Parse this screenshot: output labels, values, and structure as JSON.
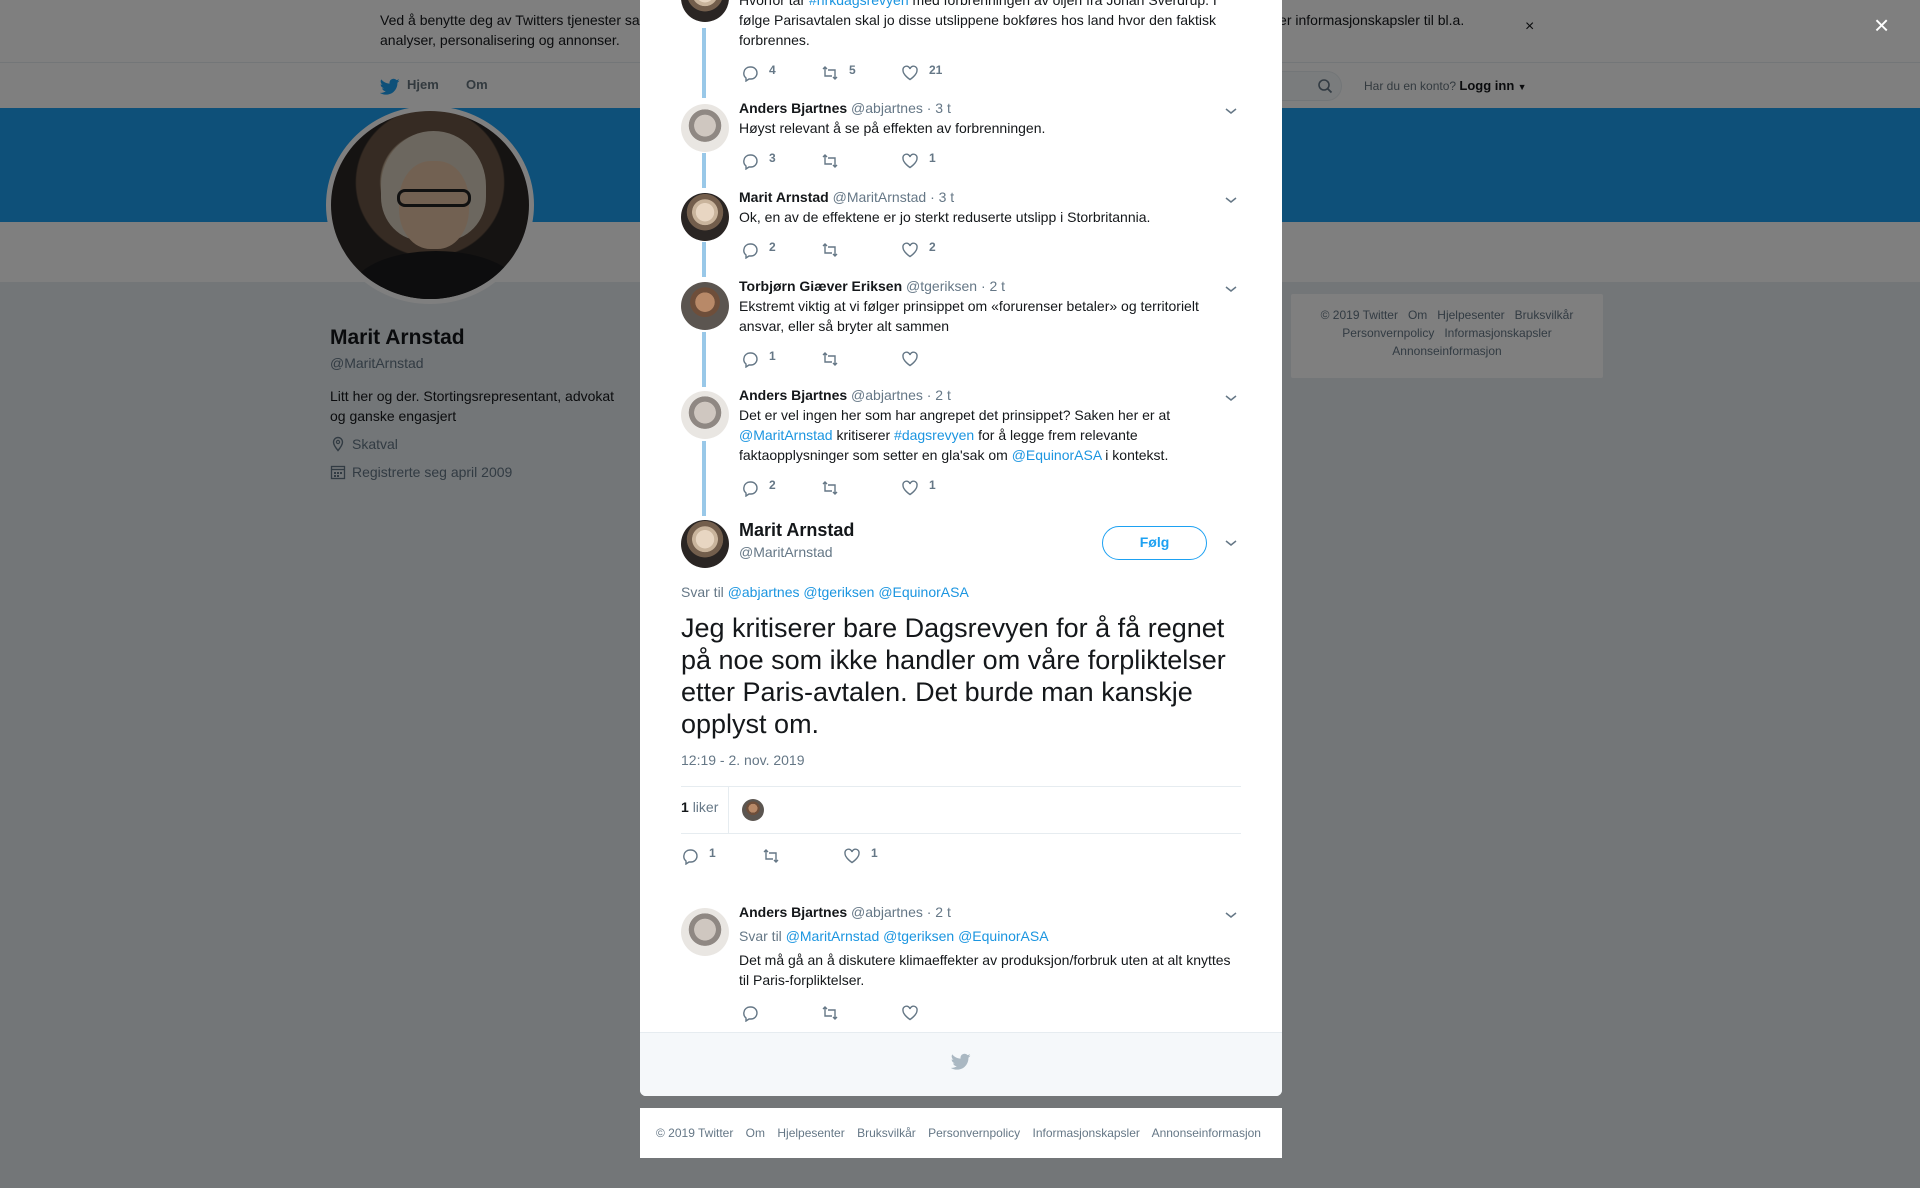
{
  "cookie": {
    "text": "Ved å benytte deg av Twitters tjenester samtykker du til vår bruk av informasjonskapsler og at data overføres ut av EU. Vi og våre partnere benytter informasjonskapsler til bl.a. analyser, personalisering og annonser.",
    "close": "×"
  },
  "nav": {
    "home": "Hjem",
    "about": "Om",
    "have_account": "Har du en konto?",
    "login": "Logg inn"
  },
  "profile": {
    "name": "Marit Arnstad",
    "handle": "@MaritArnstad",
    "bio": "Litt her og der. Stortingsrepresentant, advokat og ganske engasjert",
    "location": "Skatval",
    "joined": "Registrerte seg april 2009"
  },
  "side_footer": {
    "items": [
      "© 2019 Twitter",
      "Om",
      "Hjelpesenter",
      "Bruksvilkår",
      "Personvernpolicy",
      "Informasjonskapsler",
      "Annonseinformasjon"
    ]
  },
  "modal": {
    "close": "×",
    "top_tweet": {
      "text_a": "Hvorfor tar ",
      "link": "#nrkdagsrevyen",
      "text_b": " med forbrenningen av oljen fra Johan Sverdrup. I følge Parisavtalen skal jo disse utslippene bokføres hos land hvor den faktisk forbrennes.",
      "replies": "4",
      "retweets": "5",
      "likes": "21"
    },
    "tweets": [
      {
        "name": "Anders Bjartnes",
        "handle": "@abjartnes",
        "time": "· 3 t",
        "text": "Høyst relevant å se på effekten av forbrenningen.",
        "replies": "3",
        "retweets": "",
        "likes": "1"
      },
      {
        "name": "Marit Arnstad",
        "handle": "@MaritArnstad",
        "time": "· 3 t",
        "text": "Ok, en av de effektene er jo sterkt reduserte utslipp i Storbritannia.",
        "replies": "2",
        "retweets": "",
        "likes": "2"
      },
      {
        "name": "Torbjørn Giæver Eriksen",
        "handle": "@tgeriksen",
        "time": "· 2 t",
        "text": "Ekstremt viktig at vi følger prinsippet om «forurenser betaler» og territorielt ansvar, eller så bryter alt sammen",
        "replies": "1",
        "retweets": "",
        "likes": ""
      },
      {
        "name": "Anders Bjartnes",
        "handle": "@abjartnes",
        "time": "· 2 t",
        "text_a": "Det er vel ingen her som har angrepet det prinsippet? Saken her er at ",
        "mention1": "@MaritArnstad",
        "text_b": " kritiserer ",
        "hashtag": "#dagsrevyen",
        "text_c": " for å legge frem relevante faktaopplysninger som setter en gla'sak om ",
        "mention2": "@EquinorASA",
        "text_d": " i kontekst.",
        "replies": "2",
        "retweets": "",
        "likes": "1"
      }
    ],
    "focus": {
      "name": "Marit Arnstad",
      "handle": "@MaritArnstad",
      "follow": "Følg",
      "reply_prefix": "Svar til",
      "reply_to": [
        "@abjartnes",
        "@tgeriksen",
        "@EquinorASA"
      ],
      "text": "Jeg kritiserer bare Dagsrevyen for å få regnet på noe som ikke handler om våre forpliktelser etter Paris-avtalen. Det burde man kanskje opplyst om.",
      "timestamp": "12:19 - 2. nov. 2019",
      "like_count": "1",
      "like_label": "liker",
      "replies": "1",
      "retweets": "",
      "likes": "1"
    },
    "reply": {
      "name": "Anders Bjartnes",
      "handle": "@abjartnes",
      "time": "· 2 t",
      "reply_prefix": "Svar til",
      "reply_to": [
        "@MaritArnstad",
        "@tgeriksen",
        "@EquinorASA"
      ],
      "text": "Det må gå an å diskutere klimaeffekter av produksjon/forbruk uten at alt knyttes til Paris-forpliktelser.",
      "replies": "",
      "retweets": "",
      "likes": ""
    }
  },
  "bottom_footer": {
    "items": [
      "© 2019 Twitter",
      "Om",
      "Hjelpesenter",
      "Bruksvilkår",
      "Personvernpolicy",
      "Informasjonskapsler",
      "Annonseinformasjon"
    ]
  },
  "colors": {
    "brand": "#1da1f2",
    "link": "#1b95e0",
    "muted": "#657786"
  }
}
